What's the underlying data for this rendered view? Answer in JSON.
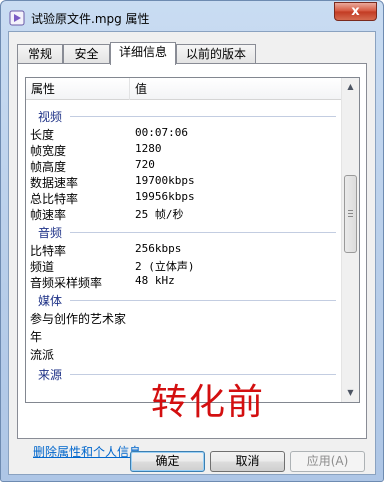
{
  "window": {
    "title": "试验原文件.mpg 属性",
    "close_glyph": "x"
  },
  "tabs": [
    {
      "label": "常规"
    },
    {
      "label": "安全"
    },
    {
      "label": "详细信息"
    },
    {
      "label": "以前的版本"
    }
  ],
  "active_tab": "详细信息",
  "list": {
    "col_property": "属性",
    "col_value": "值",
    "groups": [
      {
        "label": "视频",
        "rows": [
          {
            "k": "长度",
            "v": "00:07:06"
          },
          {
            "k": "帧宽度",
            "v": "1280"
          },
          {
            "k": "帧高度",
            "v": "720"
          },
          {
            "k": "数据速率",
            "v": "19700kbps"
          },
          {
            "k": "总比特率",
            "v": "19956kbps"
          },
          {
            "k": "帧速率",
            "v": "25 帧/秒"
          }
        ]
      },
      {
        "label": "音频",
        "rows": [
          {
            "k": "比特率",
            "v": "256kbps"
          },
          {
            "k": "频道",
            "v": "2 (立体声)"
          },
          {
            "k": "音频采样频率",
            "v": "48 kHz"
          }
        ]
      },
      {
        "label": "媒体",
        "rows": [
          {
            "k": "参与创作的艺术家",
            "v": ""
          },
          {
            "k": "年",
            "v": ""
          },
          {
            "k": "流派",
            "v": ""
          }
        ]
      },
      {
        "label": "来源",
        "rows": []
      }
    ]
  },
  "remove_link": "删除属性和个人信息",
  "watermark": "转化前",
  "buttons": {
    "ok": "确定",
    "cancel": "取消",
    "apply": "应用(A)"
  },
  "colors": {
    "group_label": "#1e3287",
    "link": "#0066cc",
    "watermark": "#d30f10"
  }
}
